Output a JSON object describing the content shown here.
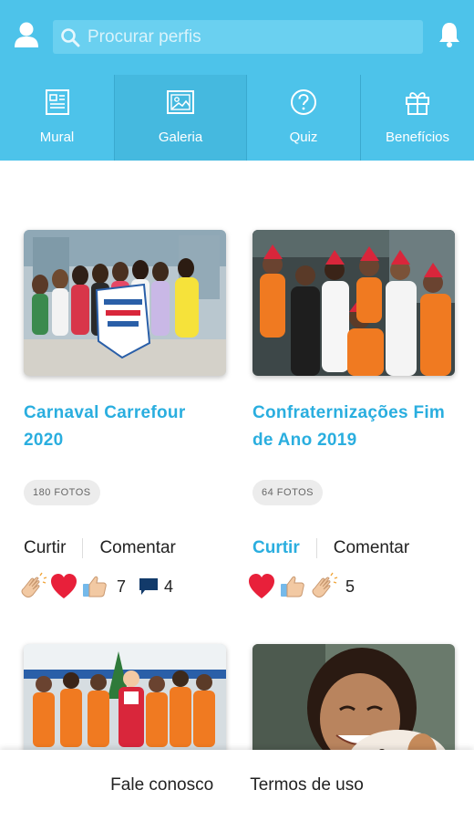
{
  "search": {
    "placeholder": "Procurar perfis"
  },
  "icons": {
    "user": "user-icon",
    "search": "search-icon",
    "bell": "bell-icon"
  },
  "colors": {
    "header": "#4dc3ea",
    "accent": "#2aaedf",
    "heart": "#e8203a"
  },
  "tabs": [
    {
      "label": "Mural",
      "icon": "newspaper-icon"
    },
    {
      "label": "Galeria",
      "icon": "image-icon",
      "active": true
    },
    {
      "label": "Quiz",
      "icon": "question-icon"
    },
    {
      "label": "Benefícios",
      "icon": "gift-icon"
    }
  ],
  "albums": [
    {
      "title_line1": "Carnaval Carrefour",
      "title_line2": "2020",
      "photos": "180 FOTOS",
      "like_label": "Curtir",
      "liked": false,
      "comment_label": "Comentar",
      "reaction_count": "7",
      "comment_count": "4"
    },
    {
      "title_line1": "Confraternizações Fim",
      "title_line2": "de Ano 2019",
      "photos": "64 FOTOS",
      "like_label": "Curtir",
      "liked": true,
      "comment_label": "Comentar",
      "reaction_count": "5"
    }
  ],
  "footer": {
    "contact": "Fale conosco",
    "terms": "Termos de uso"
  }
}
